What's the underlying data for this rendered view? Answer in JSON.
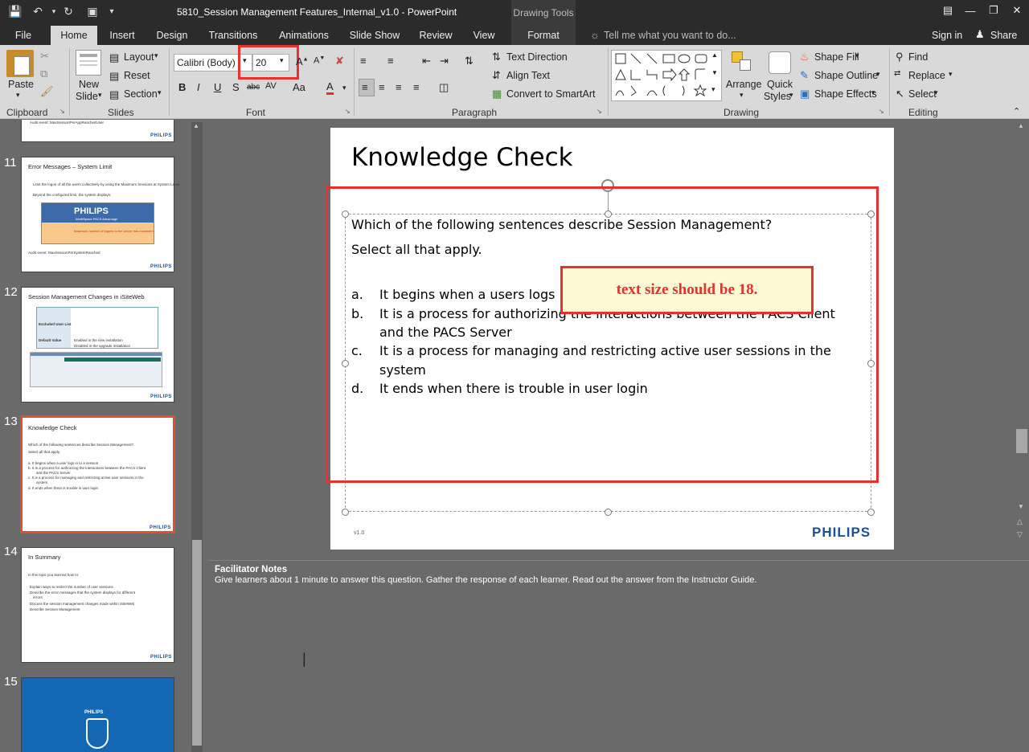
{
  "window": {
    "title": "5810_Session Management Features_Internal_v1.0 - PowerPoint",
    "context_tab": "Drawing Tools"
  },
  "tabs": [
    "File",
    "Home",
    "Insert",
    "Design",
    "Transitions",
    "Animations",
    "Slide Show",
    "Review",
    "View",
    "Format"
  ],
  "tell_me": "Tell me what you want to do...",
  "account": {
    "signin": "Sign in",
    "share": "Share"
  },
  "ribbon": {
    "clipboard": {
      "paste": "Paste",
      "group": "Clipboard"
    },
    "slides": {
      "new_slide_1": "New",
      "new_slide_2": "Slide",
      "layout": "Layout",
      "reset": "Reset",
      "section": "Section",
      "group": "Slides"
    },
    "font": {
      "family": "Calibri (Body)",
      "size": "20",
      "group": "Font",
      "bold": "B",
      "italic": "I",
      "underline": "U",
      "shadow": "S",
      "strike": "abc",
      "spacing": "AV",
      "case": "Aa",
      "color_a": "A"
    },
    "paragraph": {
      "text_direction": "Text Direction",
      "align_text": "Align Text",
      "smartart": "Convert to SmartArt",
      "group": "Paragraph"
    },
    "drawing": {
      "arrange": "Arrange",
      "quick_styles_1": "Quick",
      "quick_styles_2": "Styles",
      "shape_fill": "Shape Fill",
      "shape_outline": "Shape Outline",
      "shape_effects": "Shape Effects",
      "group": "Drawing"
    },
    "editing": {
      "find": "Find",
      "replace": "Replace",
      "select": "Select",
      "group": "Editing"
    }
  },
  "thumbnails": {
    "t10": {
      "line": "Audit event:  MaxSessionPerAppReachedUser"
    },
    "t11": {
      "num": "11",
      "title": "Error Messages – System Limit",
      "b1": "Limit the logon of all the users collectively by using the  Maximum Sessions at System Level.",
      "b2": "Beyond the configured limit, the system displays:",
      "banner": "PHILIPS",
      "banner_sub": "IntelliSpace PACS Advantage",
      "msg": "Maximum number of logons to the server has exceeded",
      "audit": "Audit event:  MaxSessionPerSystemReached"
    },
    "t12": {
      "num": "12",
      "title": "Session Management Changes in  iSiteWeb",
      "r1": "Excluded User List",
      "r2": "Default Value",
      "v1": "Enabled in the new installation",
      "v2": "Disabled in the upgrade installation"
    },
    "t13": {
      "num": "13",
      "title": "Knowledge Check",
      "q": "Which of the following sentences describe Session Management?",
      "s": "Select all that apply.",
      "a": "a.     It begins when a user logs in to a session",
      "b": "b.     It is a process for authorizing the interactions between the PACS Client",
      "b2": "and the PACS Server",
      "c": "c.     It is a process for managing and restricting active user sessions in the",
      "c2": "system",
      "d": "d.     It ends when there is trouble in user login"
    },
    "t14": {
      "num": "14",
      "title": "In Summary",
      "i": "In this topic you learned how to:",
      "l1": "Explain ways to restrict the number of user sessions",
      "l2": "Describe the error messages that the system displays for different",
      "l2b": "errors",
      "l3": "Discuss the session management changes made within iSiteWeb",
      "l4": "Describe Session Management"
    },
    "t15": {
      "num": "15"
    },
    "logo": "PHILIPS"
  },
  "slide": {
    "title": "Knowledge Check",
    "question": "Which of the following sentences describe Session Management?",
    "instruction": "Select all that apply.",
    "options": [
      {
        "letter": "a.",
        "text": "It begins when a users logs in"
      },
      {
        "letter": "b.",
        "text": "It is a process for authorizing the interactions between the PACS Client",
        "cont": "and the PACS Server"
      },
      {
        "letter": "c.",
        "text": "It is a process for managing and restricting active user sessions in the",
        "cont": "system"
      },
      {
        "letter": "d.",
        "text": "It ends when there is trouble in user login"
      }
    ],
    "footer_version": "v1.0",
    "logo": "PHILIPS"
  },
  "annotation": {
    "text": "text size should be 18."
  },
  "notes": {
    "heading": "Facilitator Notes",
    "body": "Give learners about 1 minute to answer this question. Gather the response of each learner. Read out the answer from the Instructor Guide."
  },
  "colors": {
    "accent_red": "#e8312f",
    "selection_orange": "#e0512a",
    "philips_blue": "#1a4f9c"
  }
}
